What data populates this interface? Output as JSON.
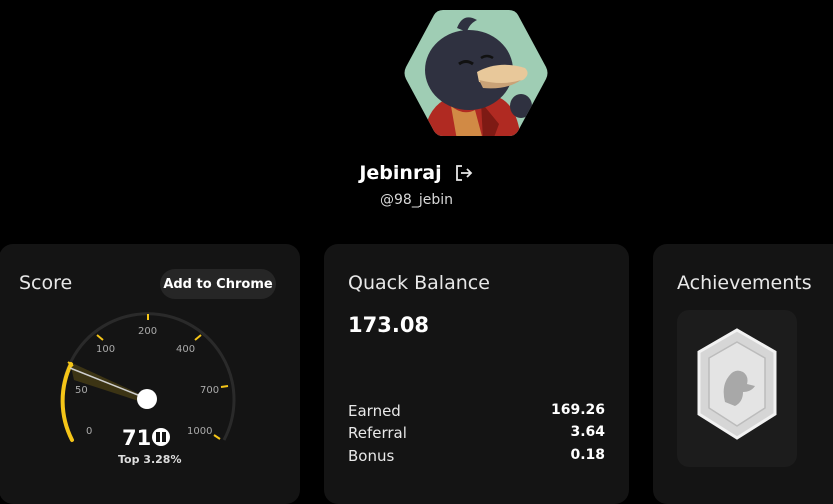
{
  "profile": {
    "name": "Jebinraj",
    "handle": "@98_jebin"
  },
  "score_card": {
    "title": "Score",
    "button_label": "Add to Chrome",
    "ticks": [
      "0",
      "50",
      "100",
      "200",
      "400",
      "700",
      "1000"
    ],
    "score_value": "71",
    "rank_text": "Top 3.28%",
    "accent_color": "#f5c518"
  },
  "balance_card": {
    "title": "Quack Balance",
    "balance": "173.08",
    "rows": [
      {
        "label": "Earned",
        "value": "169.26"
      },
      {
        "label": "Referral",
        "value": "3.64"
      },
      {
        "label": "Bonus",
        "value": "0.18"
      }
    ]
  },
  "achievements_card": {
    "title": "Achievements",
    "badge_icon": "duck-badge-icon"
  }
}
